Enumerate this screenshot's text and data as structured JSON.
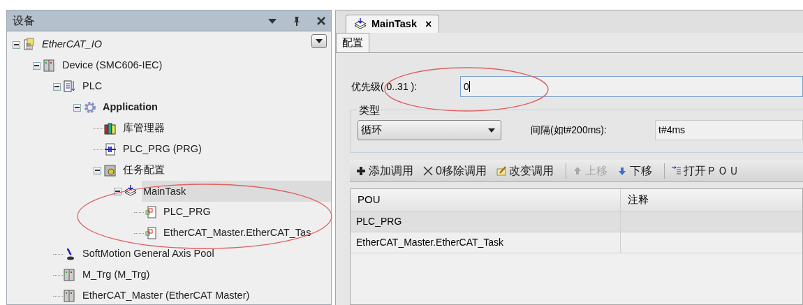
{
  "devices_panel": {
    "title": "设备",
    "tree": [
      {
        "label": "EtherCAT_IO",
        "kind": "project",
        "expanded": true,
        "selected": false,
        "children": [
          {
            "label": "Device (SMC606-IEC)",
            "kind": "device",
            "expanded": true,
            "selected": false,
            "children": [
              {
                "label": "PLC",
                "kind": "plc",
                "expanded": true,
                "selected": false,
                "children": [
                  {
                    "label": "Application",
                    "kind": "application",
                    "expanded": true,
                    "selected": false,
                    "children": [
                      {
                        "label": "库管理器",
                        "kind": "library",
                        "selected": false
                      },
                      {
                        "label": "PLC_PRG (PRG)",
                        "kind": "program",
                        "selected": false
                      },
                      {
                        "label": "任务配置",
                        "kind": "taskconfig",
                        "expanded": true,
                        "selected": false,
                        "children": [
                          {
                            "label": "MainTask",
                            "kind": "task",
                            "expanded": true,
                            "selected": true,
                            "children": [
                              {
                                "label": "PLC_PRG",
                                "kind": "call",
                                "selected": false
                              },
                              {
                                "label": "EtherCAT_Master.EtherCAT_Tas",
                                "kind": "call",
                                "selected": false
                              }
                            ]
                          }
                        ]
                      }
                    ]
                  }
                ]
              },
              {
                "label": "SoftMotion General Axis Pool",
                "kind": "axis",
                "selected": false
              },
              {
                "label": "M_Trg (M_Trg)",
                "kind": "device",
                "selected": false
              },
              {
                "label": "EtherCAT_Master (EtherCAT Master)",
                "kind": "device",
                "selected": false
              }
            ]
          }
        ]
      }
    ]
  },
  "editor": {
    "tabs": [
      {
        "label": "MainTask",
        "close": "×",
        "selected": true
      }
    ],
    "subtabs": [
      {
        "label": "配置",
        "selected": true
      }
    ],
    "priority": {
      "label": "优先级( 0..31 ):",
      "value": "0"
    },
    "type_group": {
      "title": "类型",
      "dropdown": "循环",
      "interval_label": "间隔(如t#200ms):",
      "interval_value": "t#4ms"
    },
    "toolbar": [
      {
        "label": "添加调用",
        "kind": "plus",
        "disabled": false
      },
      {
        "label": "0移除调用",
        "kind": "cross",
        "disabled": false
      },
      {
        "label": "改变调用",
        "kind": "edit",
        "disabled": false
      },
      {
        "label": "上移",
        "kind": "up",
        "disabled": true
      },
      {
        "label": "下移",
        "kind": "down",
        "disabled": false
      },
      {
        "label": "打开ＰＯＵ",
        "kind": "open",
        "disabled": false
      }
    ],
    "table": {
      "columns": [
        "POU",
        "注释"
      ],
      "rows": [
        {
          "cells": [
            "PLC_PRG",
            ""
          ],
          "selected": true
        },
        {
          "cells": [
            "EtherCAT_Master.EtherCAT_Task",
            ""
          ],
          "selected": false
        }
      ]
    }
  }
}
